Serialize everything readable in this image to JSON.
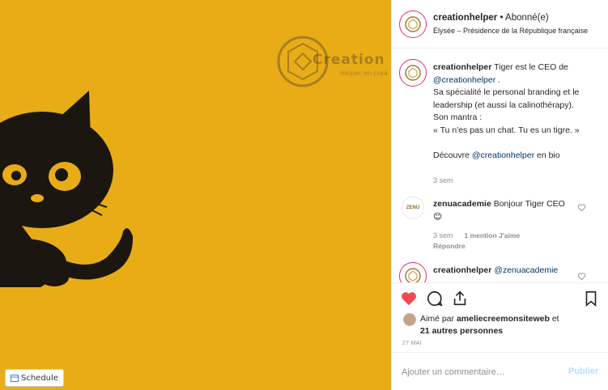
{
  "image": {
    "background_color": "#e8ac17",
    "watermark_text": "Creation He",
    "watermark_sub": "Helper en crea",
    "schedule_label": "Schedule"
  },
  "header": {
    "username": "creationhelper",
    "separator": " • ",
    "follow_status": "Abonné(e)",
    "location": "Élysée – Présidence de la République française"
  },
  "caption": {
    "username": "creationhelper",
    "line1": " Tiger est le CEO de",
    "mention1": "@creationhelper",
    "line2": " .",
    "line3": "Sa spécialité le personal branding et le leadership (et aussi la calinothérapy).",
    "line4": "Son mantra :",
    "line5": "« Tu n'es pas un chat. Tu es un tigre. »",
    "line6_prefix": "Découvre ",
    "mention2": "@creationhelper",
    "line6_suffix": " en bio",
    "time": "3 sem"
  },
  "comment1": {
    "avatar_text": "ZENU",
    "username": "zenuacademie",
    "text": " Bonjour Tiger CEO ",
    "emoji": "😊",
    "time": "3 sem",
    "likes": "1 mention J'aime",
    "reply": "Répondre"
  },
  "comment2": {
    "username": "creationhelper",
    "mention": "@zenuacademie"
  },
  "actions": {
    "liked_by_prefix": "Aimé par ",
    "liked_by_user": "ameliecreemonsiteweb",
    "liked_by_middle": " et ",
    "liked_by_others": "21 autres personnes",
    "date": "27 MAI"
  },
  "add_comment": {
    "placeholder": "Ajouter un commentaire…",
    "publish_label": "Publier"
  },
  "colors": {
    "like_red": "#ed4956",
    "mention_blue": "#003569",
    "ring_pink": "#e1306c"
  }
}
